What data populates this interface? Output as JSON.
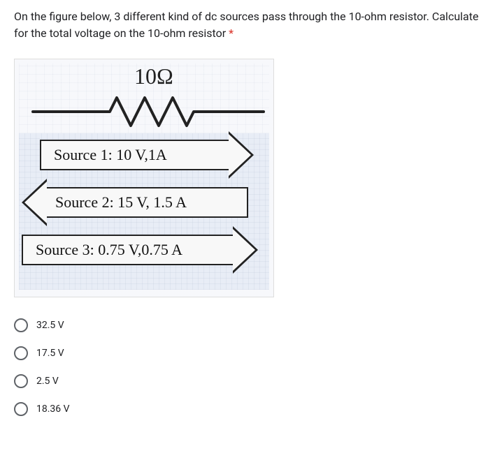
{
  "question": {
    "text_part1": "On the figure below, 3 different kind of dc sources pass through the 10-ohm resistor. Calculate for the total voltage on the 10-ohm resistor",
    "required_marker": " *"
  },
  "figure": {
    "resistor_label": "10Ω",
    "source1": "Source 1: 10 V,1A",
    "source2": "Source 2: 15 V, 1.5 A",
    "source3": "Source 3: 0.75 V,0.75 A"
  },
  "options": [
    {
      "label": "32.5 V"
    },
    {
      "label": "17.5 V"
    },
    {
      "label": "2.5 V"
    },
    {
      "label": "18.36 V"
    }
  ]
}
